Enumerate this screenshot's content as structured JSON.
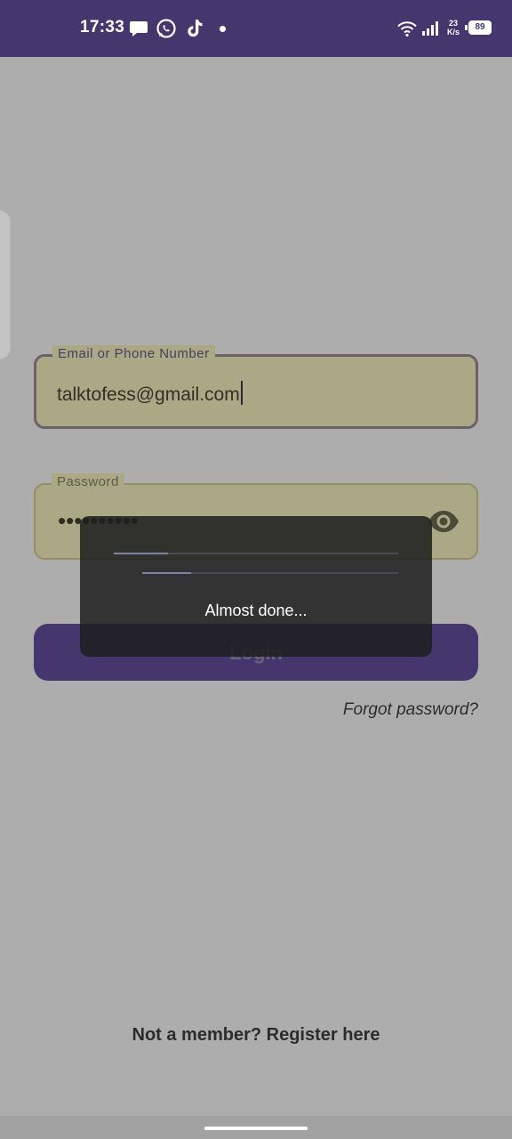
{
  "status_bar": {
    "time": "17:33",
    "net_speed_value": "23",
    "net_speed_unit": "K/s",
    "battery_level": "89",
    "notification_icons": [
      "chat-bubble-icon",
      "whatsapp-icon",
      "tiktok-icon"
    ],
    "system_icons": [
      "wifi-icon",
      "signal-icon",
      "battery-icon"
    ]
  },
  "login_form": {
    "email_label": "Email or Phone Number",
    "email_value": "talktofess@gmail.com",
    "password_label": "Password",
    "password_masked": "••••••••••",
    "show_password_icon": "eye-icon",
    "login_button_label": "Login",
    "forgot_password_label": "Forgot password?",
    "register_label": "Not a member? Register here"
  },
  "loading_dialog": {
    "message": "Almost done...",
    "progress_bars": [
      0.19,
      0.19
    ]
  },
  "colors": {
    "primary": "#45366e",
    "field_background": "#aba886",
    "background": "#adadad",
    "dialog_background": "#1e1e1e"
  }
}
